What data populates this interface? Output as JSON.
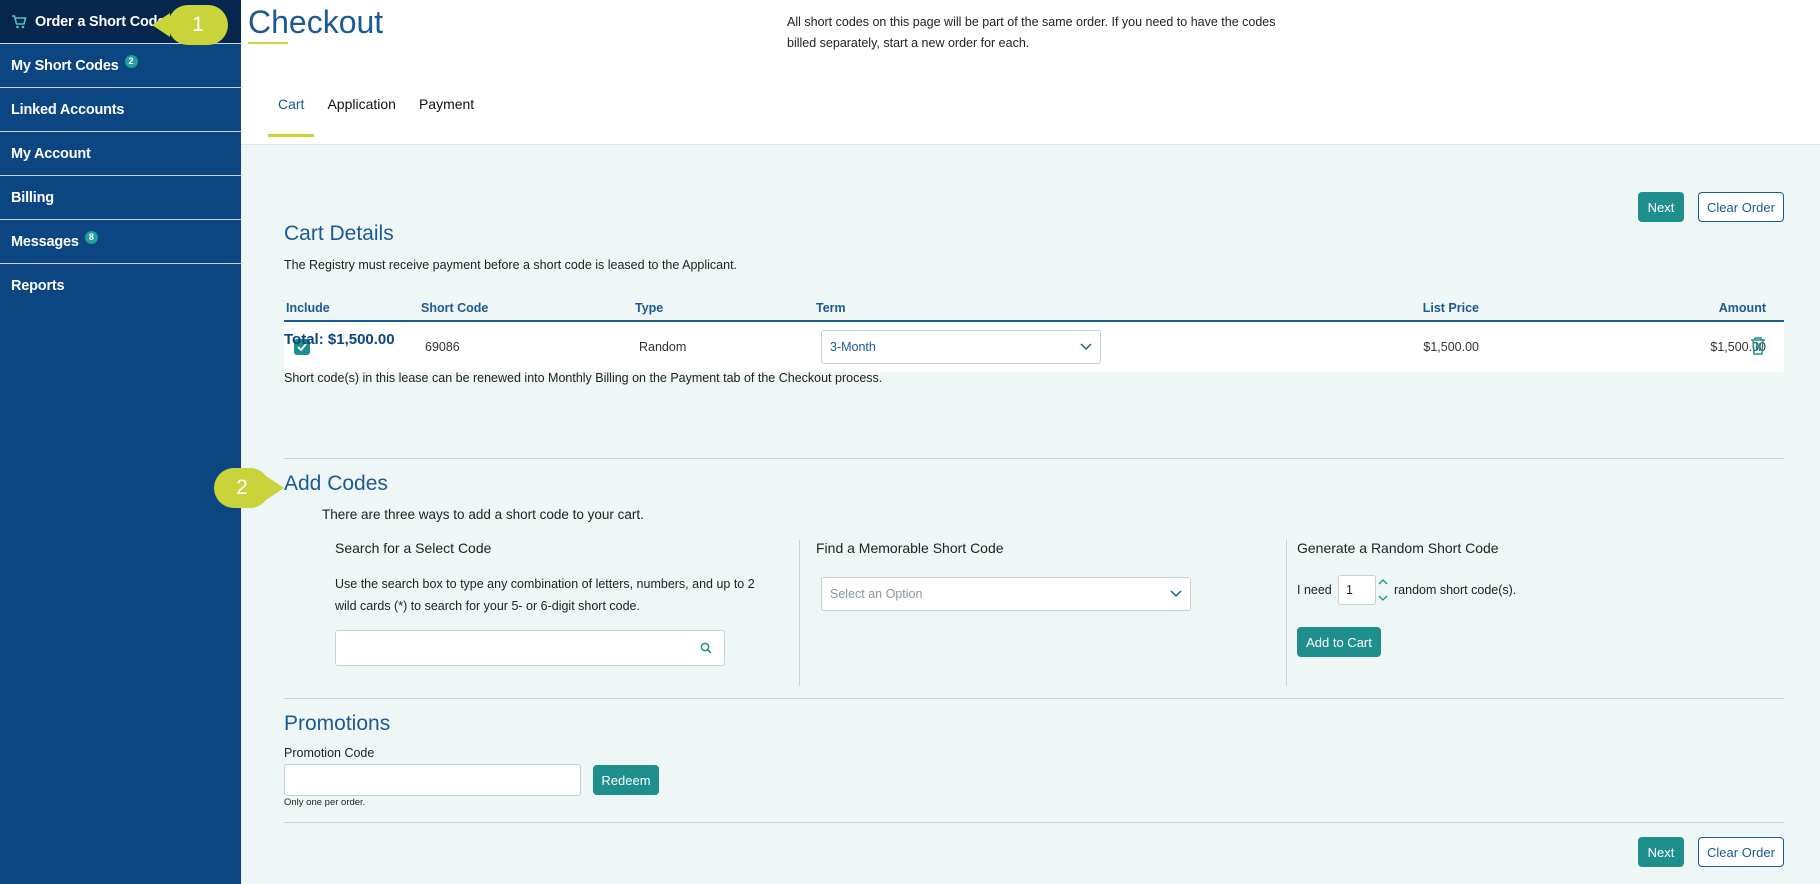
{
  "sidebar": {
    "items": [
      {
        "label": "Order a Short Code",
        "badge": ""
      },
      {
        "label": "My Short Codes",
        "badge": "2"
      },
      {
        "label": "Linked Accounts",
        "badge": ""
      },
      {
        "label": "My Account",
        "badge": ""
      },
      {
        "label": "Billing",
        "badge": ""
      },
      {
        "label": "Messages",
        "badge": "8"
      },
      {
        "label": "Reports",
        "badge": ""
      }
    ]
  },
  "callouts": {
    "one": "1",
    "two": "2"
  },
  "header": {
    "title": "Checkout",
    "notice": "All short codes on this page will be part of the same order. If you need to have the codes billed separately, start a new order for each.",
    "tabs": [
      {
        "label": "Cart"
      },
      {
        "label": "Application"
      },
      {
        "label": "Payment"
      }
    ]
  },
  "actions": {
    "next_label": "Next",
    "clear_label": "Clear Order"
  },
  "cart": {
    "title": "Cart Details",
    "subtitle": "The Registry must receive payment before a short code is leased to the Applicant.",
    "columns": {
      "include": "Include",
      "short_code": "Short Code",
      "type": "Type",
      "term": "Term",
      "list_price": "List Price",
      "amount": "Amount"
    },
    "rows": [
      {
        "code": "69086",
        "type": "Random",
        "term": "3-Month",
        "list_price": "$1,500.00",
        "amount": "$1,500.00",
        "included": true
      }
    ],
    "total": "Total: $1,500.00",
    "renew_note": "Short code(s) in this lease can be renewed into Monthly Billing on the Payment tab of the Checkout process."
  },
  "add_codes": {
    "title": "Add Codes",
    "intro": "There are three ways to add a short code to your cart.",
    "search": {
      "title": "Search for a Select Code",
      "desc": "Use the search box to type any combination of letters, numbers, and up to 2 wild cards (*) to search for your 5- or 6-digit short code.",
      "value": ""
    },
    "memorable": {
      "title": "Find a Memorable Short Code",
      "placeholder": "Select an Option"
    },
    "random": {
      "title": "Generate a Random Short Code",
      "prefix": "I need",
      "quantity": "1",
      "suffix": "random short code(s).",
      "button": "Add to Cart"
    }
  },
  "promotions": {
    "title": "Promotions",
    "label": "Promotion Code",
    "value": "",
    "button": "Redeem",
    "note": "Only one per order."
  },
  "colors": {
    "sidebar": "#0b4582",
    "accent": "#1f8f8d",
    "heading": "#1b5a94",
    "highlight": "#c8d43a",
    "page_bg": "#eef6f6"
  }
}
